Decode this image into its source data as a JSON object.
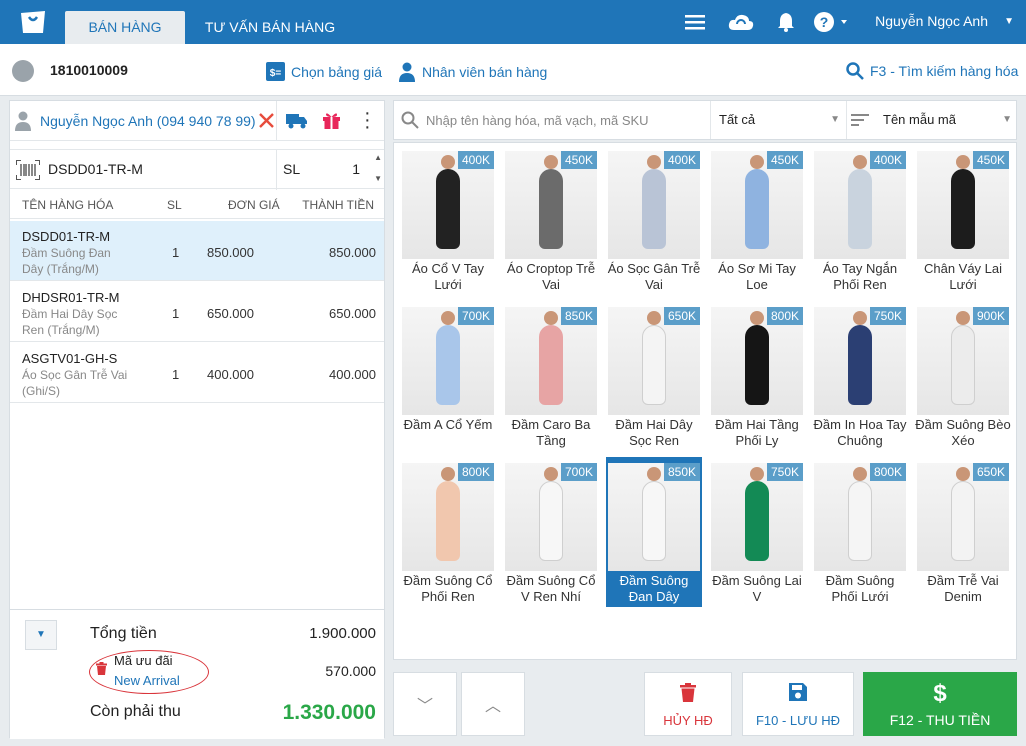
{
  "header": {
    "tabs": [
      {
        "label": "BÁN HÀNG"
      },
      {
        "label": "TƯ VẤN BÁN HÀNG"
      }
    ],
    "user_name": "Nguyễn Ngọc Anh",
    "colors": {
      "brand": "#1f75b8",
      "green": "#2aa748",
      "danger": "#d9353b"
    }
  },
  "subbar": {
    "order_code": "1810010009",
    "price_list": "Chọn bảng giá",
    "staff": "Nhân viên bán hàng",
    "search_hotkey": "F3 - Tìm kiếm hàng hóa"
  },
  "cart": {
    "customer": "Nguyễn Ngọc Anh (094 940 78 99)",
    "scan_code": "DSDD01-TR-M",
    "qty_label": "SL",
    "qty_value": "1",
    "columns": [
      "TÊN HÀNG HÓA",
      "SL",
      "ĐƠN GIÁ",
      "THÀNH TIỀN"
    ],
    "items": [
      {
        "code": "DSDD01-TR-M",
        "name": "Đầm Suông Đan Dây (Trắng/M)",
        "qty": "1",
        "price": "850.000",
        "total": "850.000"
      },
      {
        "code": "DHDSR01-TR-M",
        "name": "Đầm Hai Dây Sọc Ren (Trắng/M)",
        "qty": "1",
        "price": "650.000",
        "total": "650.000"
      },
      {
        "code": "ASGTV01-GH-S",
        "name": "Áo Sọc Gân Trễ Vai (Ghi/S)",
        "qty": "1",
        "price": "400.000",
        "total": "400.000"
      }
    ],
    "total_label": "Tổng tiền",
    "total_value": "1.900.000",
    "promo_label": "Mã ưu đãi",
    "promo_name": "New Arrival",
    "promo_value": "570.000",
    "due_label": "Còn phải thu",
    "due_value": "1.330.000"
  },
  "catalog": {
    "search_placeholder": "Nhập tên hàng hóa, mã vạch, mã SKU",
    "category": "Tất cả",
    "sort": "Tên mẫu mã",
    "products": [
      {
        "name": "Áo Cổ V Tay Lưới",
        "price": "400K",
        "color": "#222222"
      },
      {
        "name": "Áo Croptop Trễ Vai",
        "price": "450K",
        "color": "#6b6b6b"
      },
      {
        "name": "Áo Sọc Gân Trễ Vai",
        "price": "400K",
        "color": "#b9c4d6"
      },
      {
        "name": "Áo Sơ Mi Tay Loe",
        "price": "450K",
        "color": "#8fb3e0"
      },
      {
        "name": "Áo Tay Ngắn Phối Ren",
        "price": "400K",
        "color": "#c9d3de"
      },
      {
        "name": "Chân Váy Lai Lưới",
        "price": "450K",
        "color": "#1c1c1c"
      },
      {
        "name": "Đầm A Cổ Yếm",
        "price": "700K",
        "color": "#a9c6ea"
      },
      {
        "name": "Đầm Caro Ba Tầng",
        "price": "850K",
        "color": "#e7a4a4"
      },
      {
        "name": "Đầm Hai Dây Sọc Ren",
        "price": "650K",
        "color": "#f4f4f4"
      },
      {
        "name": "Đầm Hai Tầng Phối Ly",
        "price": "800K",
        "color": "#151515"
      },
      {
        "name": "Đầm In Hoa Tay Chuông",
        "price": "750K",
        "color": "#2b3f73"
      },
      {
        "name": "Đầm Suông Bèo Xéo",
        "price": "900K",
        "color": "#ececec"
      },
      {
        "name": "Đầm Suông Cổ Phối Ren",
        "price": "800K",
        "color": "#f1c7ae"
      },
      {
        "name": "Đầm Suông Cổ V Ren Nhí",
        "price": "700K",
        "color": "#f7f7f7"
      },
      {
        "name": "Đầm Suông Đan Dây",
        "price": "850K",
        "color": "#f7f7f7"
      },
      {
        "name": "Đầm Suông Lai V",
        "price": "750K",
        "color": "#138a55"
      },
      {
        "name": "Đầm Suông Phối Lưới",
        "price": "800K",
        "color": "#f5f5f5"
      },
      {
        "name": "Đầm Trễ Vai Denim",
        "price": "650K",
        "color": "#f3f3f3"
      }
    ]
  },
  "actions": {
    "cancel": "HỦY HĐ",
    "save": "F10 - LƯU HĐ",
    "pay": "F12 - THU TIỀN"
  }
}
